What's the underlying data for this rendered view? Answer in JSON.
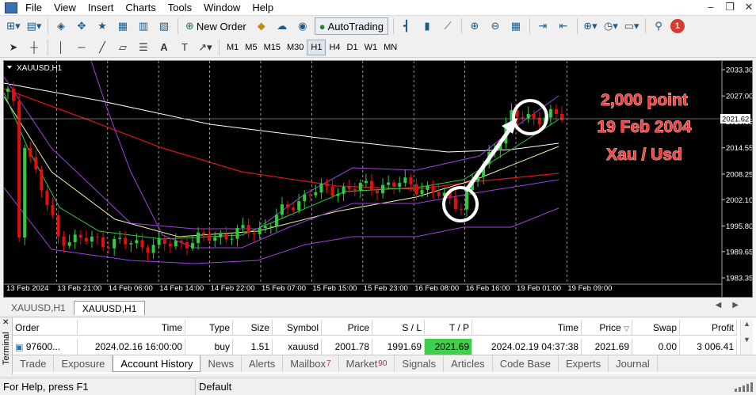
{
  "menu": [
    "File",
    "View",
    "Insert",
    "Charts",
    "Tools",
    "Window",
    "Help"
  ],
  "toolbar": {
    "new_order": "New Order",
    "autotrading": "AutoTrading",
    "badge": "1"
  },
  "timeframes": [
    "M1",
    "M5",
    "M15",
    "M30",
    "H1",
    "H4",
    "D1",
    "W1",
    "MN"
  ],
  "active_timeframe": "H1",
  "chart": {
    "symbol_label": "XAUUSD,H1",
    "current_price_label": "2021.62",
    "annotation": {
      "line1": "2,000 point",
      "line2": "19 Feb 2004",
      "line3": "Xau / Usd"
    },
    "price_ticks": [
      "2033.30",
      "2027.00",
      "2020.85",
      "2014.55",
      "2008.25",
      "2002.10",
      "1995.80",
      "1989.65",
      "1983.35"
    ],
    "time_ticks": [
      "13 Feb 2024",
      "13 Feb 21:00",
      "14 Feb 06:00",
      "14 Feb 14:00",
      "14 Feb 22:00",
      "15 Feb 07:00",
      "15 Feb 15:00",
      "15 Feb 23:00",
      "16 Feb 08:00",
      "16 Feb 16:00",
      "19 Feb 01:00",
      "19 Feb 09:00"
    ],
    "colors": {
      "up": "#2ecc40",
      "down": "#e01010",
      "bg": "#000000",
      "arrow": "#ffffff",
      "annotation": "#ff3333"
    }
  },
  "chart_data": {
    "type": "line",
    "title": "XAUUSD,H1",
    "xlabel": "",
    "ylabel": "",
    "ylim": [
      1983.35,
      2033.3
    ],
    "x": [
      "13 Feb 2024",
      "13 Feb 21:00",
      "14 Feb 06:00",
      "14 Feb 14:00",
      "14 Feb 22:00",
      "15 Feb 07:00",
      "15 Feb 15:00",
      "15 Feb 23:00",
      "16 Feb 08:00",
      "16 Feb 16:00",
      "19 Feb 01:00",
      "19 Feb 09:00"
    ],
    "series": [
      {
        "name": "",
        "values": [
          2028,
          1993,
          1992,
          1991,
          1993,
          1995,
          2004,
          2005,
          2006,
          2001,
          2022,
          2022
        ]
      }
    ],
    "current_price": 2021.62
  },
  "chart_tabs": [
    "XAUUSD,H1",
    "XAUUSD,H1"
  ],
  "active_chart_tab": 1,
  "terminal": {
    "side_label": "Terminal",
    "columns": [
      "Order",
      "Time",
      "Type",
      "Size",
      "Symbol",
      "Price",
      "S / L",
      "T / P",
      "Time",
      "Price",
      "Swap",
      "Profit"
    ],
    "rows": [
      [
        "97600...",
        "2024.02.16 16:00:00",
        "buy",
        "1.51",
        "xauusd",
        "2001.78",
        "1991.69",
        "2021.69",
        "2024.02.19 04:37:38",
        "2021.69",
        "0.00",
        "3 006.41"
      ]
    ]
  },
  "bottom_tabs": [
    {
      "label": "Trade",
      "count": ""
    },
    {
      "label": "Exposure",
      "count": ""
    },
    {
      "label": "Account History",
      "count": ""
    },
    {
      "label": "News",
      "count": ""
    },
    {
      "label": "Alerts",
      "count": ""
    },
    {
      "label": "Mailbox",
      "count": "7"
    },
    {
      "label": "Market",
      "count": "90"
    },
    {
      "label": "Signals",
      "count": ""
    },
    {
      "label": "Articles",
      "count": ""
    },
    {
      "label": "Code Base",
      "count": ""
    },
    {
      "label": "Experts",
      "count": ""
    },
    {
      "label": "Journal",
      "count": ""
    }
  ],
  "active_bottom_tab": 2,
  "status": {
    "help": "For Help, press F1",
    "profile": "Default"
  }
}
